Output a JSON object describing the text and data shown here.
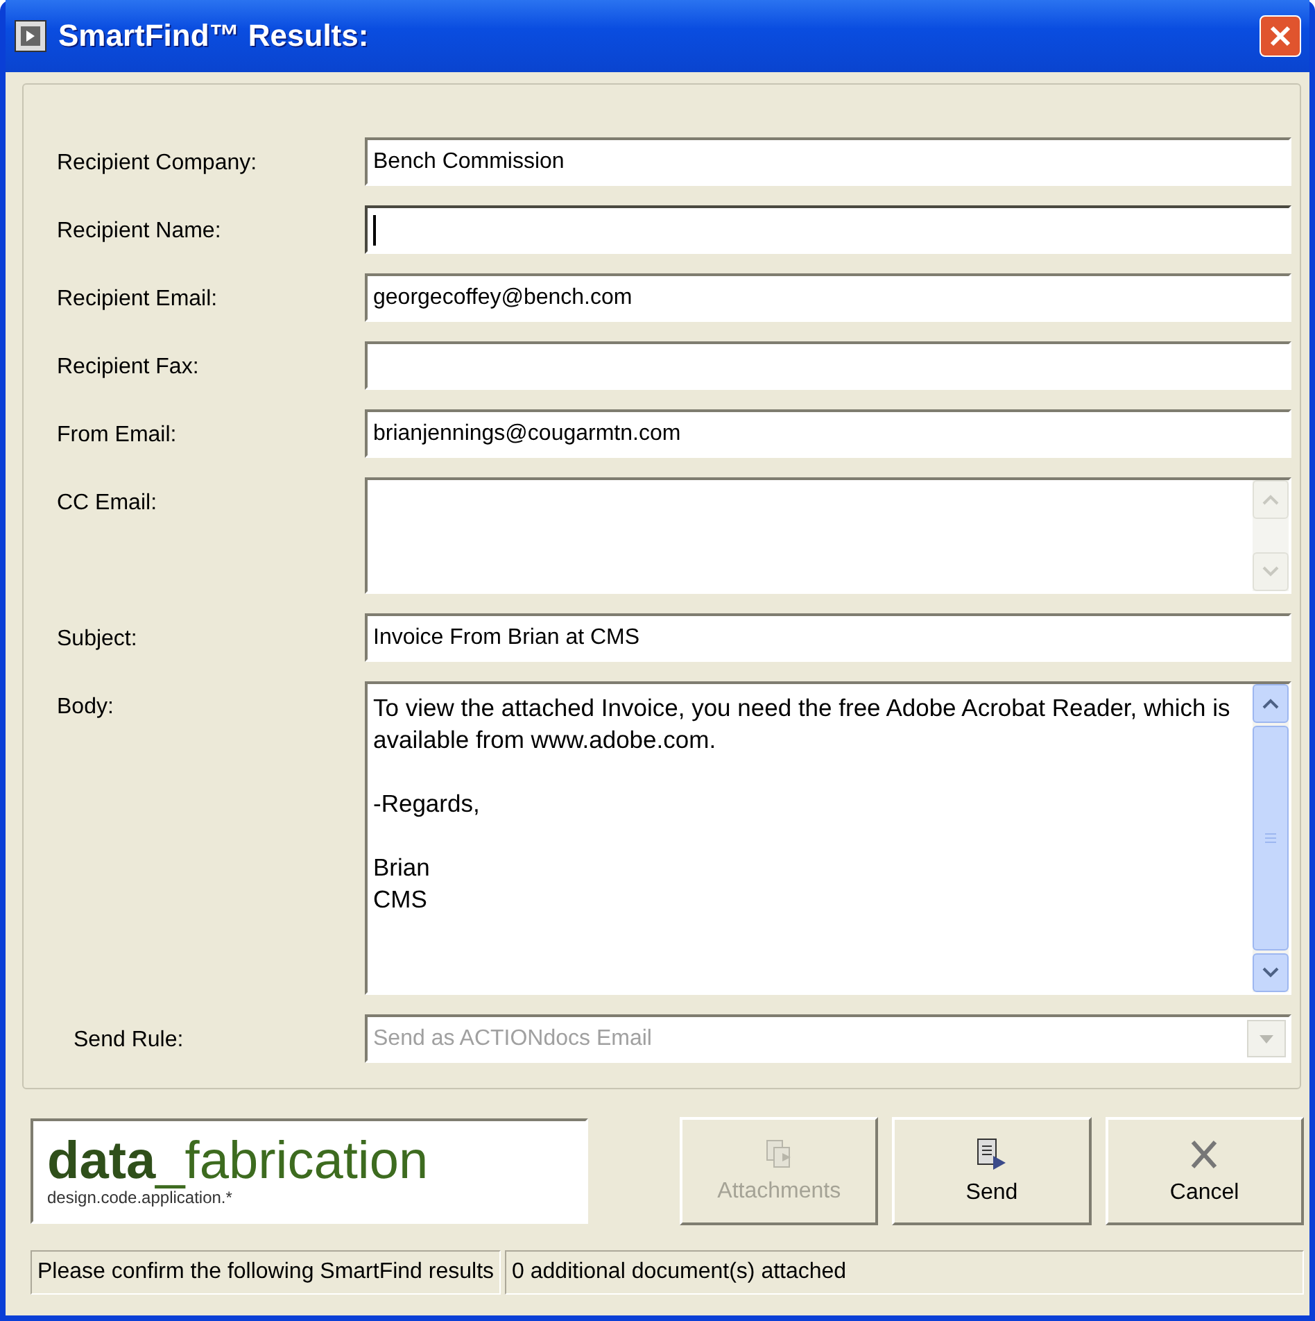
{
  "window": {
    "title": "SmartFind™ Results:"
  },
  "fields": [
    {
      "label": "Recipient Company:",
      "value": "Bench Commission",
      "kind": "line",
      "focused": false
    },
    {
      "label": "Recipient Name:",
      "kind": "line",
      "focused": true
    },
    {
      "label": "Recipient Email:",
      "value": "georgecoffey@bench.com",
      "kind": "line",
      "focused": false
    },
    {
      "label": "Recipient Fax:",
      "kind": "line",
      "focused": false
    },
    {
      "label": "From Email:",
      "value": "brianjennings@cougarmtn.com",
      "kind": "line",
      "focused": false
    },
    {
      "label": "CC Email:",
      "kind": "memo",
      "focused": false,
      "scroll_enabled": false
    },
    {
      "label": "Subject:",
      "value": "Invoice From Brian at CMS",
      "kind": "line",
      "focused": false
    },
    {
      "label": "Body:",
      "value": "To view the attached Invoice, you need the free Adobe Acrobat Reader, which is available from www.adobe.com.\n\n-Regards,\n\nBrian\nCMS",
      "kind": "body",
      "focused": false,
      "scroll_enabled": true
    },
    {
      "label": "Send Rule:",
      "value": "Send as ACTIONdocs Email",
      "kind": "select",
      "disabled": true
    }
  ],
  "logo": {
    "name": "data",
    "suffix": "_fabrication",
    "tagline": "design.code.application.*"
  },
  "buttons": [
    {
      "label": "Attachments",
      "kind": "attach",
      "disabled": true
    },
    {
      "label": "Send",
      "kind": "send",
      "disabled": false
    },
    {
      "label": "Cancel",
      "kind": "cancel",
      "disabled": false
    }
  ],
  "status_bar": [
    "Please confirm the following SmartFind results",
    "0 additional document(s) attached"
  ]
}
